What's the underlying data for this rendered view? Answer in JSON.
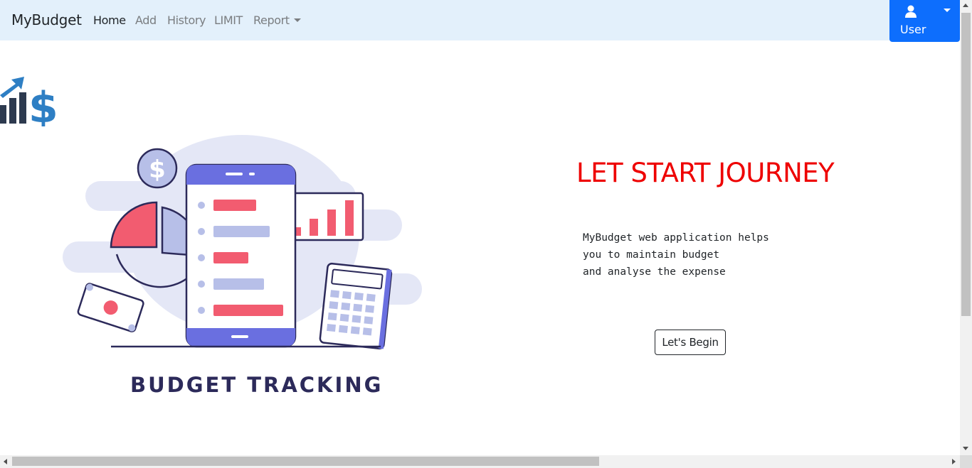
{
  "navbar": {
    "brand": "MyBudget",
    "links": [
      {
        "label": "Home",
        "active": true
      },
      {
        "label": "Add",
        "active": false
      },
      {
        "label": "History",
        "active": false
      },
      {
        "label": "LIMIT",
        "active": false
      },
      {
        "label": "Report",
        "active": false,
        "dropdown": true
      }
    ],
    "user_label": "User",
    "user_icon": "user-icon"
  },
  "hero": {
    "illustration_caption": "BUDGET TRACKING",
    "headline": "LET START JOURNEY",
    "description": "MyBudget web application helps\nyou to maintain budget\nand analyse the expense",
    "button_label": "Let's Begin"
  },
  "colors": {
    "navbar_bg": "#e3f0fb",
    "user_button": "#0d6efd",
    "headline": "#ee0000",
    "illustration_accent": "#f25c70",
    "illustration_primary": "#6a6fe0"
  }
}
